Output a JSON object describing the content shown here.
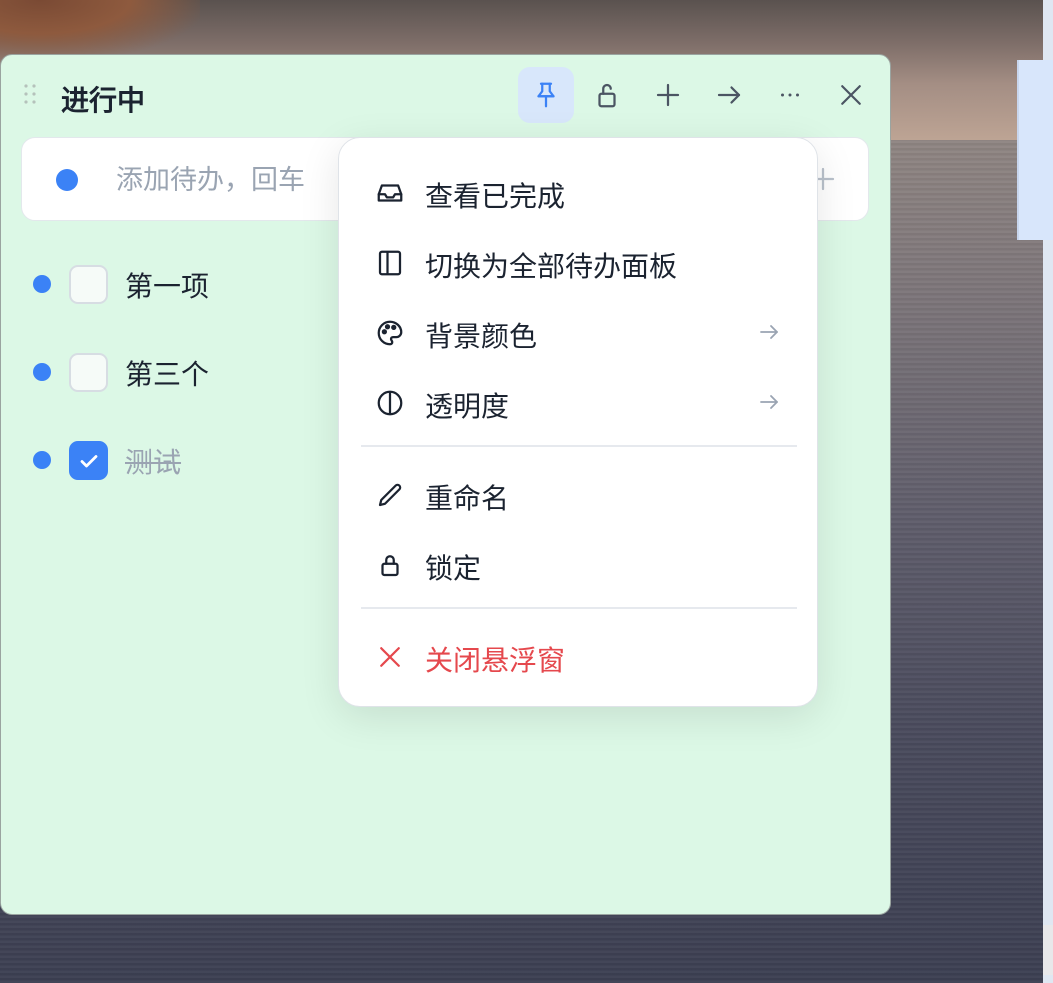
{
  "panel": {
    "title": "进行中",
    "toolbar": [
      "pin-icon",
      "unlock-icon",
      "plus-icon",
      "arrow-right-icon",
      "more-icon",
      "close-icon"
    ]
  },
  "add_todo": {
    "placeholder": "添加待办，回车"
  },
  "tasks": [
    {
      "label": "第一项",
      "done": false
    },
    {
      "label": "第三个",
      "done": false
    },
    {
      "label": "测试",
      "done": true
    }
  ],
  "menu": {
    "items": [
      {
        "label": "查看已完成",
        "icon": "inbox-icon"
      },
      {
        "label": "切换为全部待办面板",
        "icon": "panel-icon"
      },
      {
        "label": "背景颜色",
        "icon": "palette-icon",
        "submenu": true
      },
      {
        "label": "透明度",
        "icon": "contrast-icon",
        "submenu": true
      },
      {
        "label": "重命名",
        "icon": "pencil-icon"
      },
      {
        "label": "锁定",
        "icon": "lock-icon"
      },
      {
        "label": "关闭悬浮窗",
        "icon": "close-icon",
        "danger": true
      }
    ]
  },
  "colors": {
    "panel_bg": "#dcf8e6",
    "accent": "#3b82f6",
    "danger": "#e5484d"
  }
}
